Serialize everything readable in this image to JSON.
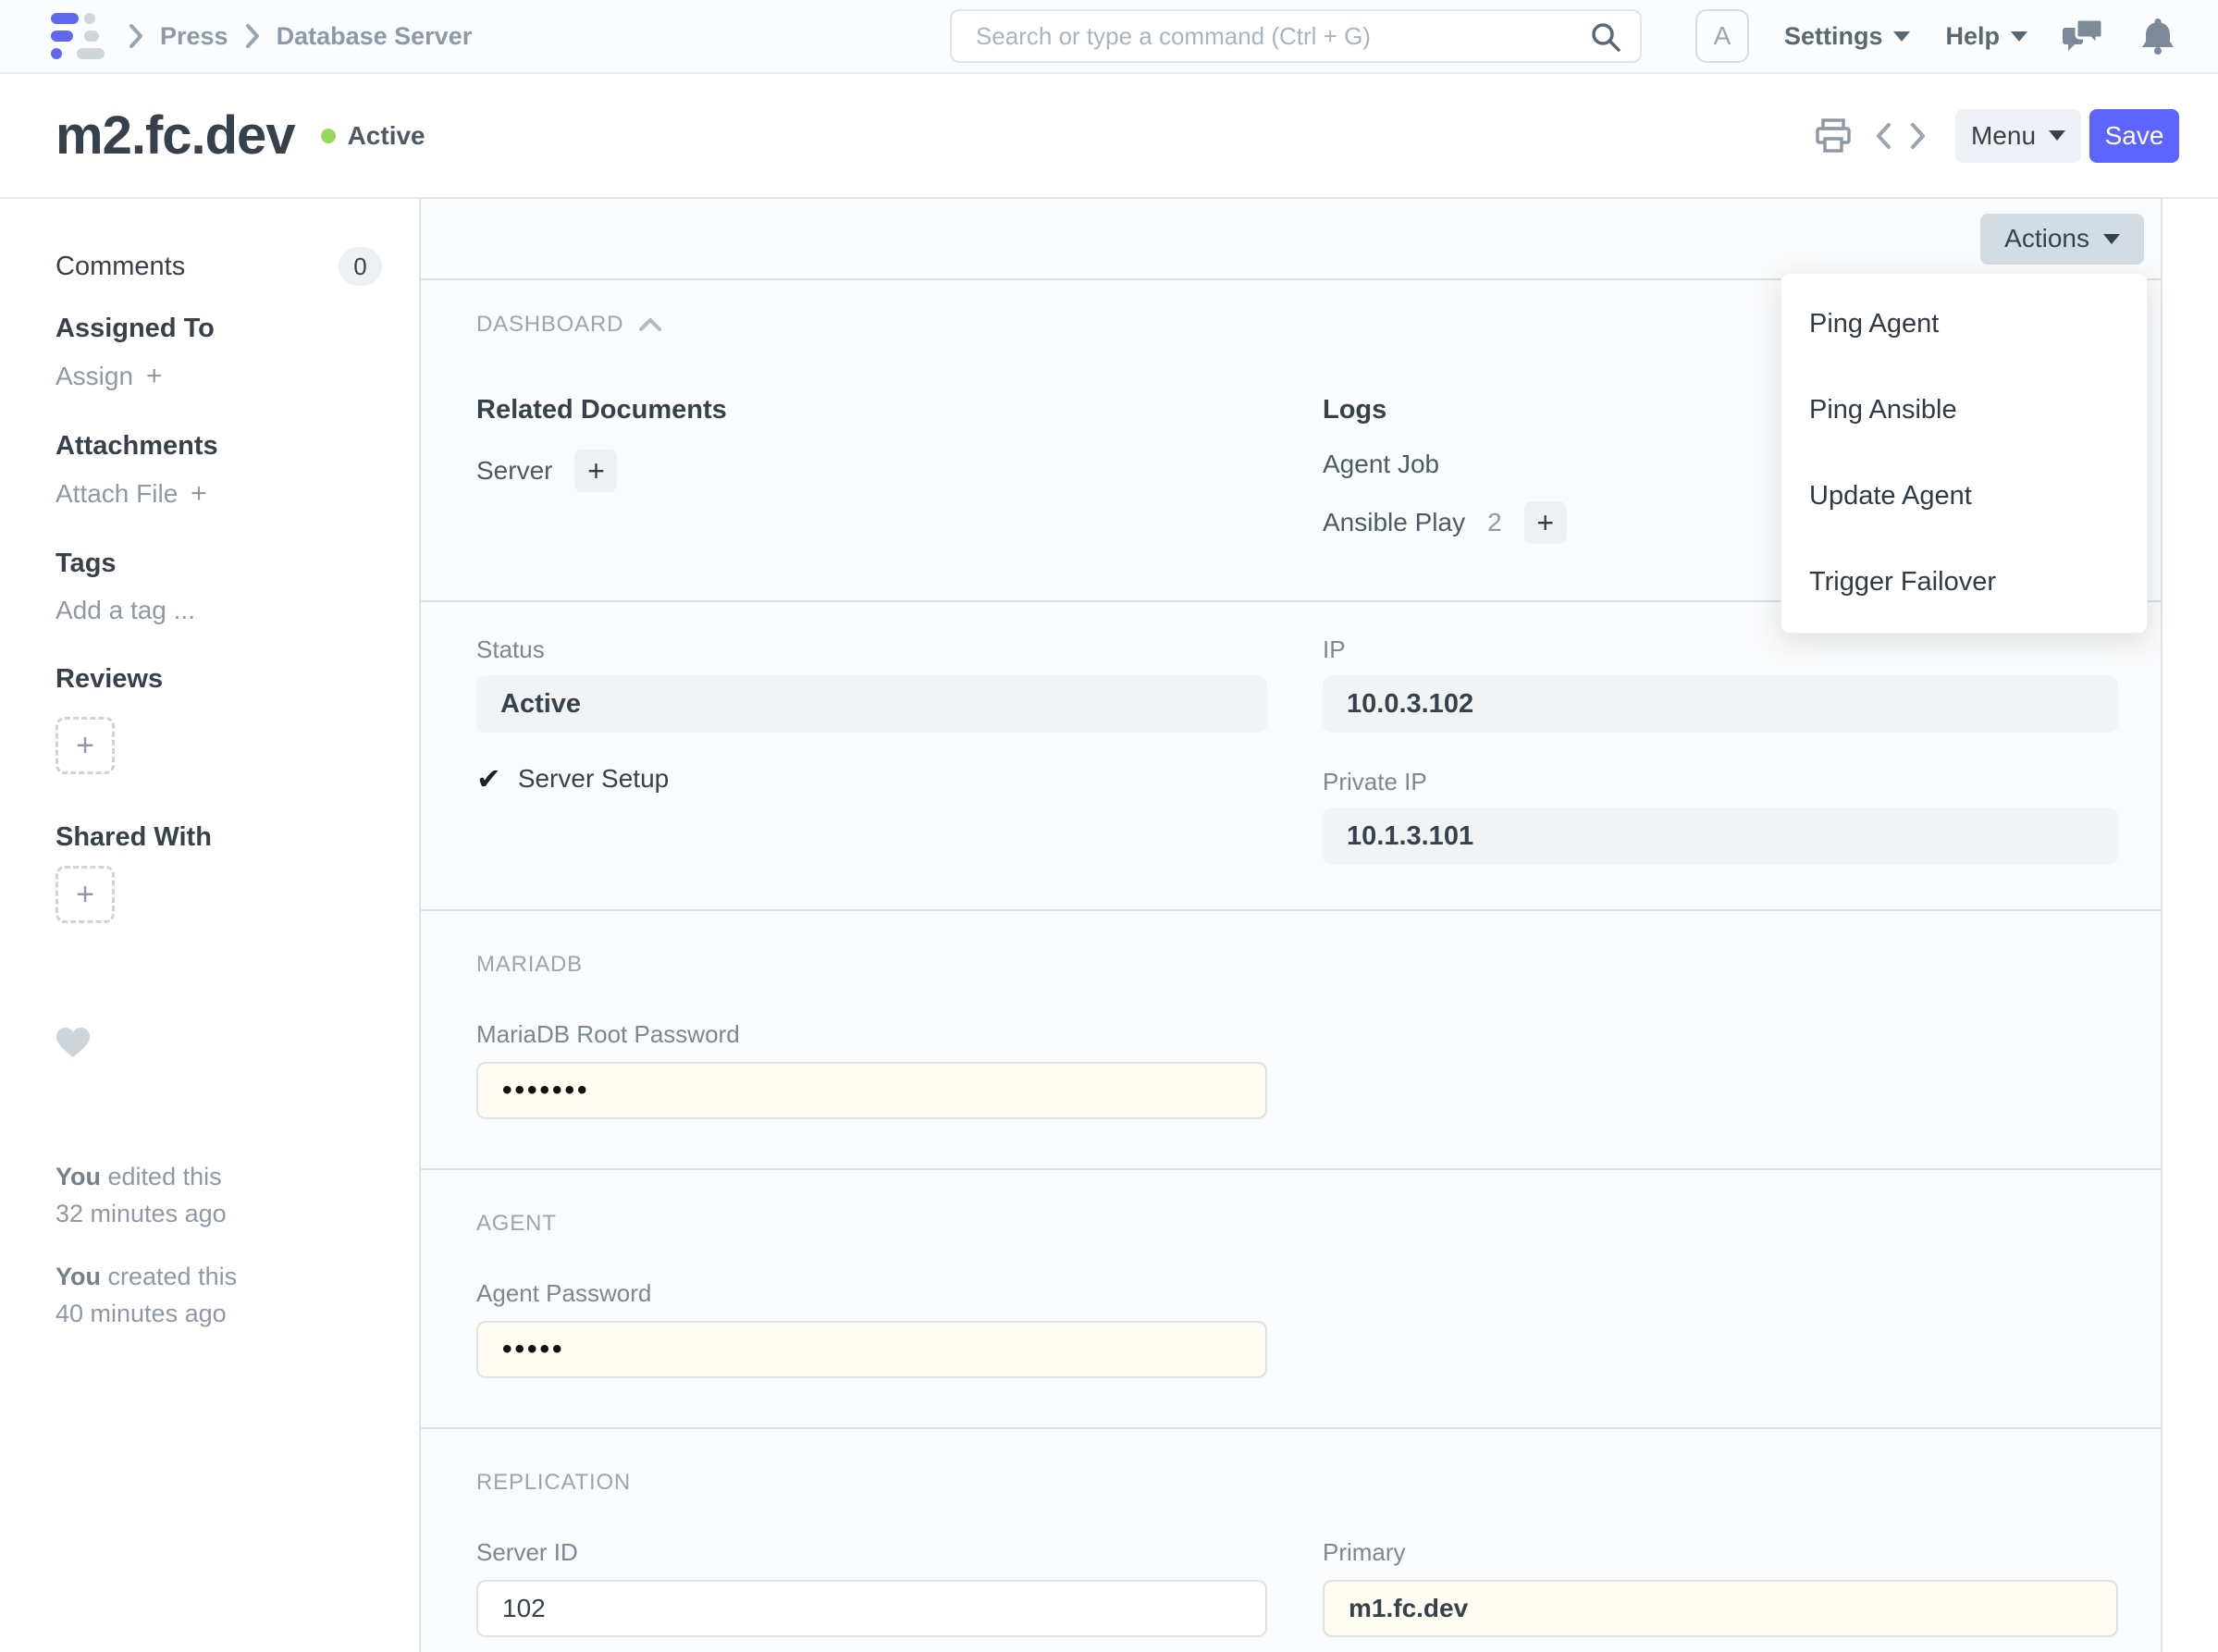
{
  "icons": {
    "plus": "+",
    "check": "✔"
  },
  "navbar": {
    "breadcrumbs": [
      {
        "label": "Press"
      },
      {
        "label": "Database Server"
      }
    ],
    "search": {
      "placeholder": "Search or type a command (Ctrl + G)"
    },
    "avatar_initial": "A",
    "settings_label": "Settings",
    "help_label": "Help"
  },
  "page_head": {
    "title": "m2.fc.dev",
    "status": "Active",
    "menu_label": "Menu",
    "save_label": "Save"
  },
  "sidebar": {
    "comments_label": "Comments",
    "comments_count": "0",
    "assigned_to_heading": "Assigned To",
    "assign_label": "Assign",
    "attachments_heading": "Attachments",
    "attach_file_label": "Attach File",
    "tags_heading": "Tags",
    "add_tag_label": "Add a tag ...",
    "reviews_heading": "Reviews",
    "shared_with_heading": "Shared With",
    "edited": {
      "who": "You",
      "action": "edited this",
      "when": "32 minutes ago"
    },
    "created": {
      "who": "You",
      "action": "created this",
      "when": "40 minutes ago"
    }
  },
  "form": {
    "actions_label": "Actions",
    "actions_menu": {
      "items": [
        "Ping Agent",
        "Ping Ansible",
        "Update Agent",
        "Trigger Failover"
      ]
    },
    "dashboard": {
      "section_label": "DASHBOARD",
      "related_heading": "Related Documents",
      "related_items": [
        {
          "label": "Server"
        }
      ],
      "logs_heading": "Logs",
      "log_items": [
        {
          "label": "Agent Job"
        },
        {
          "label": "Ansible Play",
          "count": "2"
        }
      ]
    },
    "status": {
      "label": "Status",
      "value": "Active",
      "server_setup_label": "Server Setup",
      "ip_label": "IP",
      "ip_value": "10.0.3.102",
      "private_ip_label": "Private IP",
      "private_ip_value": "10.1.3.101"
    },
    "mariadb": {
      "section_label": "MARIADB",
      "root_password_label": "MariaDB Root Password",
      "root_password_value": "•••••••"
    },
    "agent": {
      "section_label": "AGENT",
      "password_label": "Agent Password",
      "password_value": "•••••"
    },
    "replication": {
      "section_label": "REPLICATION",
      "server_id_label": "Server ID",
      "server_id_value": "102",
      "primary_label": "Primary",
      "primary_value": "m1.fc.dev"
    }
  },
  "colors": {
    "accent": "#5e64ff",
    "status_green": "#98d85b"
  }
}
